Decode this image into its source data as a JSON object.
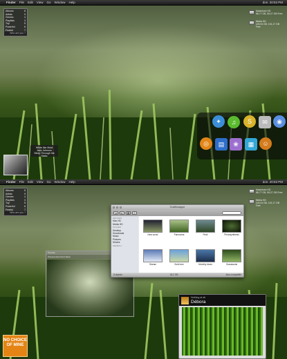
{
  "menubar": {
    "app_name": "Finder",
    "items": [
      "File",
      "Edit",
      "View",
      "Go",
      "Window",
      "Help"
    ],
    "clock": "don. 20:53 PM"
  },
  "drives": [
    {
      "name": "Macintosh HD",
      "info": "88,77 GB, 55,27 GB Free"
    },
    {
      "name": "Media HD",
      "info": "149,04 GB, 101,17 GB Free"
    }
  ],
  "widget_list": {
    "rows": [
      {
        "label": "Albums",
        "value": "8"
      },
      {
        "label": "Artists",
        "value": "9"
      },
      {
        "label": "Genres",
        "value": "4"
      },
      {
        "label": "Playlists",
        "value": "3"
      },
      {
        "label": "Top",
        "value": "5"
      },
      {
        "label": "Powerful",
        "value": "6"
      },
      {
        "label": "Fearful",
        "value": "7"
      }
    ],
    "footer": "Who are you ?"
  },
  "now_playing": {
    "lines": [
      "White like Mold",
      "Jack Johnson",
      "Sleep Through the Static"
    ]
  },
  "dock": {
    "icons": [
      "safari-icon",
      "itunes-icon",
      "skype-icon",
      "mail-icon",
      "ichat-icon",
      "firefox-icon",
      "stack-icon",
      "iphoto-icon",
      "ical-icon",
      "finder-icon"
    ]
  },
  "finder": {
    "title": "Grafikmappe",
    "sidebar": [
      {
        "type": "section",
        "label": "DEVICES"
      },
      {
        "type": "item",
        "label": "Mac HD"
      },
      {
        "type": "item",
        "label": "Media HD"
      },
      {
        "type": "section",
        "label": "PLACES"
      },
      {
        "type": "item",
        "label": "Desktop"
      },
      {
        "type": "item",
        "label": "Downloads"
      },
      {
        "type": "item",
        "label": "Music"
      },
      {
        "type": "item",
        "label": "Pictures"
      },
      {
        "type": "item",
        "label": "Movies"
      },
      {
        "type": "section",
        "label": "SEARCH"
      }
    ],
    "files": [
      {
        "label": "New world"
      },
      {
        "label": "Panorama"
      },
      {
        "label": "Field"
      },
      {
        "label": "Photosynthesis"
      },
      {
        "label": "Stream"
      },
      {
        "label": "Solid tree"
      },
      {
        "label": "Monthly blues"
      },
      {
        "label": "Grasslands"
      }
    ],
    "status_left": "8 objects",
    "status_mid": "18,2 GB",
    "status_right": "Also compatible"
  },
  "preview": {
    "title": "Preview",
    "toolbar": "Previous  Next  Zoom  Move"
  },
  "itunes": {
    "subtitle": "Nothing at all",
    "track": "Débora"
  },
  "nc_art": {
    "text": "NO CHOICE OF MINE"
  },
  "colors": {
    "accent": "#4fa319",
    "menubar": "#222222",
    "finder_bg": "#e8e8e8"
  }
}
